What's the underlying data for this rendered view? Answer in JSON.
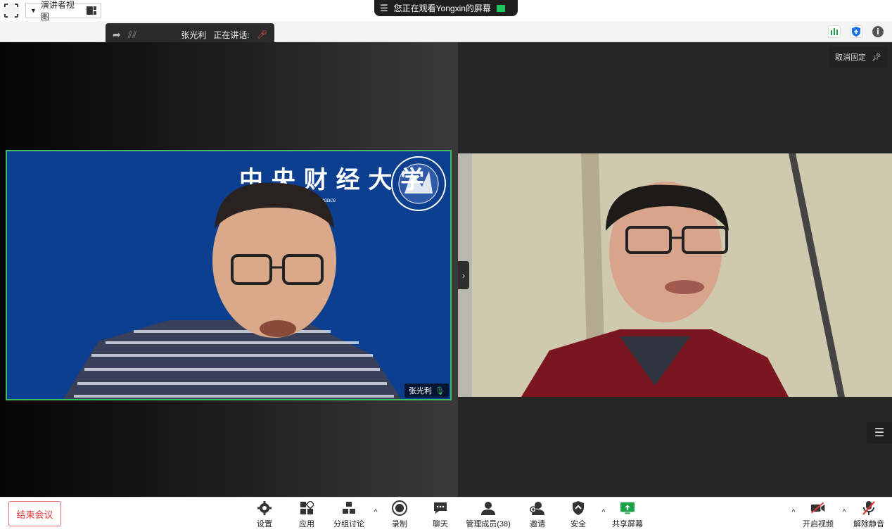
{
  "title_bar": {
    "share_notice": "您正在观看Yongxin的屏幕",
    "window_controls": [
      "close",
      "restore",
      "minimize"
    ]
  },
  "toolbar": {
    "view_label": "演讲者视图",
    "speaking_label": "正在讲话:",
    "speaking_name": "张光利"
  },
  "video": {
    "left_participant_name": "张光利",
    "unpin_label": "取消固定"
  },
  "bottom": {
    "end_meeting": "结束会议",
    "settings": "设置",
    "apps": "应用",
    "breakout": "分组讨论",
    "record": "录制",
    "chat": "聊天",
    "participants": "管理成员(38)",
    "invite": "邀请",
    "security": "安全",
    "share_screen": "共享屏幕",
    "start_video": "开启视频",
    "unmute": "解除静音"
  },
  "colors": {
    "accent_green": "#22c55e",
    "speaker_border": "#3bbf62",
    "end_red": "#e03b3b",
    "share_green": "#1aa34a"
  }
}
